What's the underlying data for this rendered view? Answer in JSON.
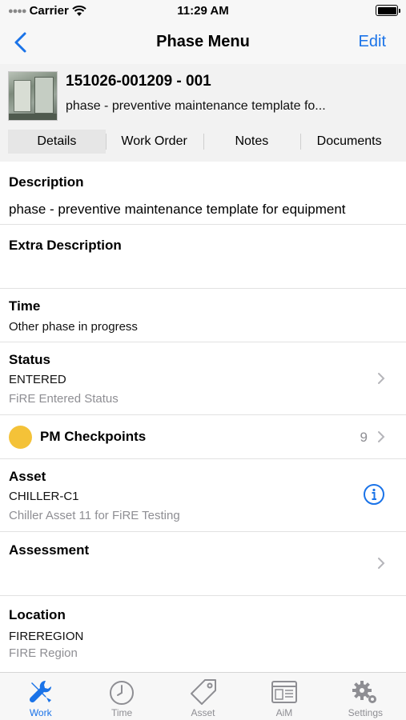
{
  "status_bar": {
    "carrier": "Carrier",
    "time": "11:29 AM"
  },
  "nav": {
    "title": "Phase Menu",
    "edit_label": "Edit"
  },
  "header": {
    "title": "151026-001209 - 001",
    "subtitle": "phase - preventive maintenance template fo...",
    "tabs": [
      {
        "label": "Details",
        "active": true
      },
      {
        "label": "Work Order",
        "active": false
      },
      {
        "label": "Notes",
        "active": false
      },
      {
        "label": "Documents",
        "active": false
      }
    ]
  },
  "sections": {
    "description": {
      "label": "Description",
      "value": "phase - preventive maintenance template for equipment"
    },
    "extra_description": {
      "label": "Extra Description",
      "value": ""
    },
    "time": {
      "label": "Time",
      "value": "Other phase in progress"
    },
    "status": {
      "label": "Status",
      "value": "ENTERED",
      "sub": "FiRE Entered Status"
    },
    "pm_checkpoints": {
      "label": "PM Checkpoints",
      "count": "9",
      "dot_color": "#f4c238"
    },
    "asset": {
      "label": "Asset",
      "value": "CHILLER-C1",
      "sub": "Chiller Asset 11 for FiRE Testing"
    },
    "assessment": {
      "label": "Assessment",
      "value": ""
    },
    "location": {
      "label": "Location",
      "value": "FIREREGION",
      "sub": "FIRE Region"
    }
  },
  "tab_bar": {
    "items": [
      {
        "label": "Work",
        "icon": "wrench-screwdriver-icon",
        "active": true
      },
      {
        "label": "Time",
        "icon": "clock-icon",
        "active": false
      },
      {
        "label": "Asset",
        "icon": "tag-icon",
        "active": false
      },
      {
        "label": "AiM",
        "icon": "browser-window-icon",
        "active": false
      },
      {
        "label": "Settings",
        "icon": "gears-icon",
        "active": false
      }
    ]
  },
  "colors": {
    "accent": "#1a73e8",
    "header_bg": "#f2f2f2",
    "checkpoint_dot": "#f4c238",
    "secondary_text": "#8e8e93"
  }
}
